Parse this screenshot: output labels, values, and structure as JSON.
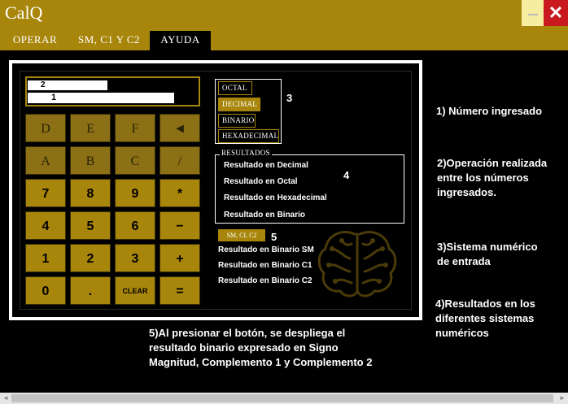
{
  "window": {
    "title": "CalQ",
    "minimize_icon": "minimize-icon",
    "close_label": "✕"
  },
  "tabs": [
    {
      "label": "OPERAR",
      "active": false
    },
    {
      "label": "SM, C1 Y C2",
      "active": false
    },
    {
      "label": "AYUDA",
      "active": true
    }
  ],
  "calculator": {
    "display": {
      "operation_marker": "2",
      "input_marker": "1"
    },
    "keys": [
      [
        "D",
        "E",
        "F",
        "◄"
      ],
      [
        "A",
        "B",
        "C",
        "/"
      ],
      [
        "7",
        "8",
        "9",
        "*"
      ],
      [
        "4",
        "5",
        "6",
        "−"
      ],
      [
        "1",
        "2",
        "3",
        "+"
      ],
      [
        "0",
        ".",
        "CLEAR",
        "="
      ]
    ],
    "base_buttons": [
      {
        "label": "OCTAL",
        "selected": false
      },
      {
        "label": "DECIMAL",
        "selected": true
      },
      {
        "label": "BINARIO",
        "selected": false
      },
      {
        "label": "HEXADECIMAL",
        "selected": false
      }
    ],
    "base_marker": "3",
    "results": {
      "legend": "RESULTADOS",
      "marker": "4",
      "items": [
        "Resultado en Decimal",
        "Resultado en Octal",
        "Resultado en Hexadecimal",
        "Resultado en Binario"
      ]
    },
    "sm_button": {
      "label": "SM, CL C2",
      "marker": "5"
    },
    "sm_results": [
      "Resultado en Binario SM",
      "Resultado en Binario C1",
      "Resultado en Binario C2"
    ]
  },
  "help_notes": {
    "note1": "1) Número ingresado",
    "note2_lines": [
      "2)Operación realizada",
      "entre los números",
      "ingresados."
    ],
    "note3_lines": [
      "3)Sistema numérico",
      "de entrada"
    ],
    "note4_lines": [
      "4)Resultados en los",
      "diferentes sistemas",
      "numéricos"
    ],
    "note5_lines": [
      "5)Al presionar el botón, se despliega el",
      "resultado binario expresado en Signo",
      "Magnitud, Complemento 1 y Complemento 2"
    ]
  },
  "colors": {
    "accent": "#a8860c",
    "close": "#c8191e",
    "background": "#000000"
  }
}
